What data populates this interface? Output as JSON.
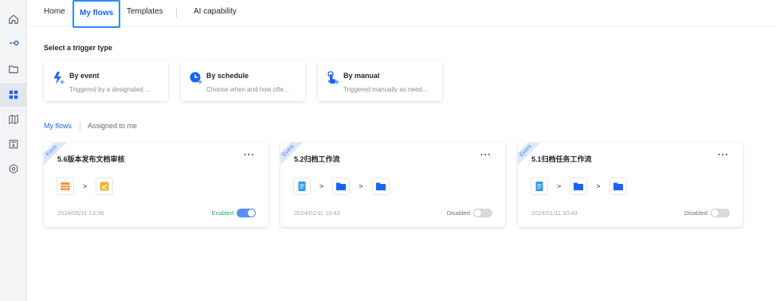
{
  "rail": {
    "items": [
      {
        "icon": "home-icon"
      },
      {
        "icon": "flow-icon"
      },
      {
        "icon": "folder-icon"
      },
      {
        "icon": "grid-icon",
        "active": true
      },
      {
        "icon": "map-icon"
      },
      {
        "icon": "text-doc-icon"
      },
      {
        "icon": "hexagon-icon"
      }
    ]
  },
  "nav": {
    "tabs": [
      {
        "label": "Home"
      },
      {
        "label": "My flows"
      },
      {
        "label": "Templates"
      },
      {
        "label": "AI capability"
      }
    ]
  },
  "trigger_section": {
    "title": "Select a trigger type",
    "cards": [
      {
        "name": "By event",
        "desc": "Triggered by a designated ...",
        "icon": "lightning-icon"
      },
      {
        "name": "By schedule",
        "desc": "Choose when and how ofte...",
        "icon": "clock-icon"
      },
      {
        "name": "By manual",
        "desc": "Triggered manually as need...",
        "icon": "hand-pointer-icon"
      }
    ]
  },
  "subtabs": {
    "my_flows": "My flows",
    "assigned": "Assigned to me"
  },
  "flows": [
    {
      "ribbon": "Form",
      "name": "5.6版本发布文档审核",
      "date": "2024/05/31 13:36",
      "status": "Enabled",
      "enabled": true,
      "nodes": [
        "table-icon",
        "approval-icon"
      ]
    },
    {
      "ribbon": "Event",
      "name": "5.2归档工作流",
      "date": "2024/01/11 10:43",
      "status": "Disabled",
      "enabled": false,
      "nodes": [
        "document-icon",
        "folder-icon",
        "folder-icon"
      ]
    },
    {
      "ribbon": "Event",
      "name": "5.1归档任务工作流",
      "date": "2024/01/11 10:43",
      "status": "Disabled",
      "enabled": false,
      "nodes": [
        "document-icon",
        "folder-icon",
        "folder-icon"
      ]
    }
  ],
  "more_label": "···",
  "arrow_label": ">",
  "colors": {
    "accent": "#1664ff",
    "enabled": "#34a870"
  }
}
